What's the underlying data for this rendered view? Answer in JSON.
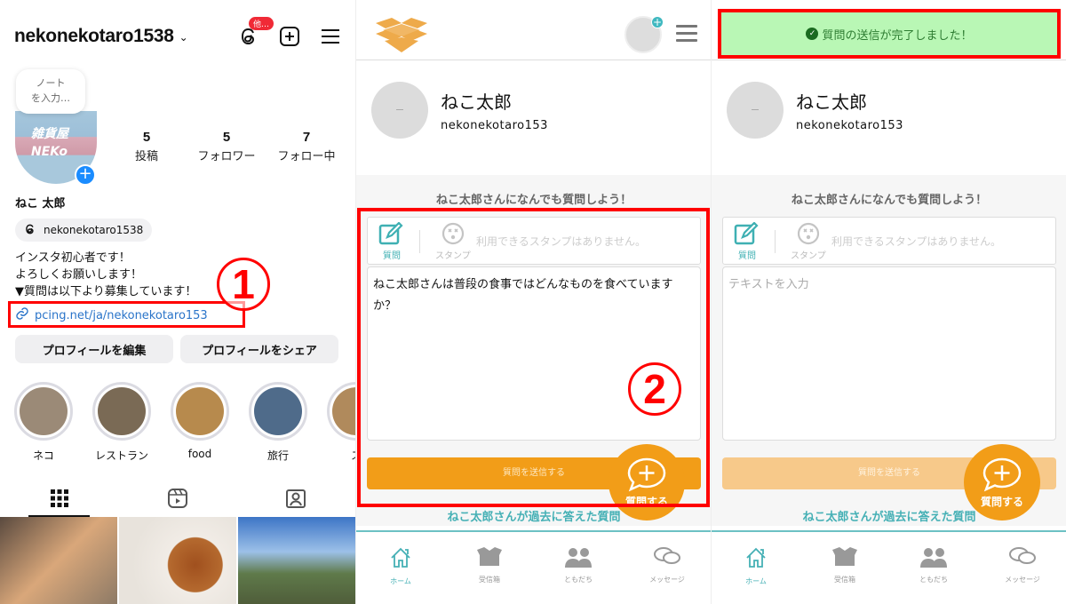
{
  "instagram": {
    "username": "nekonekotaro1538",
    "threads_badge": "他…",
    "note": {
      "line1": "ノート",
      "line2": "を入力…"
    },
    "avatar_text": {
      "line1": "雑貨屋",
      "line2": "NEKo"
    },
    "stats": [
      {
        "value": "5",
        "label": "投稿"
      },
      {
        "value": "5",
        "label": "フォロワー"
      },
      {
        "value": "7",
        "label": "フォロー中"
      }
    ],
    "display_name": "ねこ 太郎",
    "threads_handle": "nekonekotaro1538",
    "bio": [
      "インスタ初心者です！",
      "よろしくお願いします！",
      "▼質問は以下より募集しています！"
    ],
    "link": "pcing.net/ja/nekonekotaro153",
    "buttons": {
      "edit": "プロフィールを編集",
      "share": "プロフィールをシェア"
    },
    "highlights": [
      {
        "label": "ネコ",
        "color": "#9b8a77"
      },
      {
        "label": "レストラン",
        "color": "#7a6a55"
      },
      {
        "label": "food",
        "color": "#b78a4d"
      },
      {
        "label": "旅行",
        "color": "#4f6b8a"
      },
      {
        "label": "ス",
        "color": "#b08a5c"
      }
    ],
    "grid_colors": [
      "#8d7a66",
      "#c98c4d",
      "#6a8fbf"
    ]
  },
  "annotations": {
    "step1": "1",
    "step2": "2"
  },
  "peing": {
    "profile_name": "ねこ太郎",
    "profile_id": "nekonekotaro153",
    "section_title": "ねこ太郎さんになんでも質問しよう！",
    "tool_question": "質問",
    "tool_stamp": "スタンプ",
    "stamp_message": "利用できるスタンプはありません。",
    "question_text": "ねこ太郎さんは普段の食事ではどんなものを食べていますか？",
    "placeholder": "テキストを入力",
    "send_label": "質問を送信する",
    "fab_label": "質問する",
    "past_title": "ねこ太郎さんが過去に答えた質問",
    "nav": [
      {
        "label": "ホーム",
        "icon": "home-icon"
      },
      {
        "label": "受信箱",
        "icon": "box-icon"
      },
      {
        "label": "ともだち",
        "icon": "friends-icon"
      },
      {
        "label": "メッセージ",
        "icon": "messages-icon"
      }
    ],
    "toast": "質問の送信が完了しました！",
    "accent": "#45b0b5",
    "orange": "#f29d18"
  }
}
